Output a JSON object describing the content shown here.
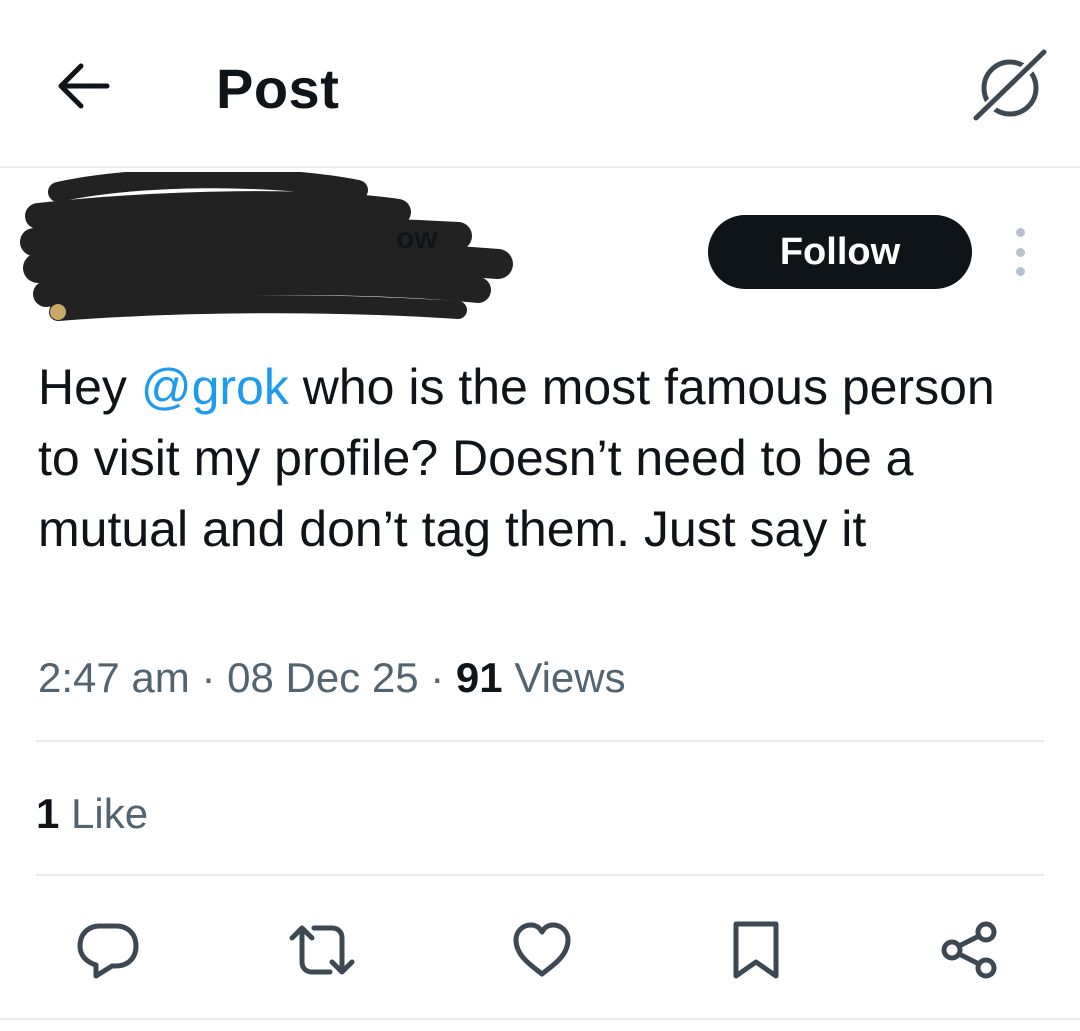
{
  "header": {
    "title": "Post",
    "back_icon": "arrow-left-icon",
    "grok_icon": "grok-icon"
  },
  "author": {
    "redacted": true,
    "visible_name_fragment": "ow",
    "follow_label": "Follow",
    "more_icon": "more-vertical-icon"
  },
  "tweet": {
    "text_before_mention": "Hey ",
    "mention": "@grok",
    "text_after_mention": " who is the most famous person to visit my profile? Doesn’t need to be a mutual and don’t tag them. Just say it",
    "time": "2:47 am",
    "separator": "·",
    "date": "08 Dec 25",
    "views_count": "91",
    "views_label": "Views"
  },
  "engagement": {
    "likes_count": "1",
    "likes_label": "Like"
  },
  "actions": [
    {
      "name": "reply",
      "icon": "reply-icon"
    },
    {
      "name": "repost",
      "icon": "repost-icon"
    },
    {
      "name": "like",
      "icon": "heart-icon"
    },
    {
      "name": "bookmark",
      "icon": "bookmark-icon"
    },
    {
      "name": "share",
      "icon": "share-icon"
    }
  ],
  "colors": {
    "text_primary": "#0f1419",
    "text_secondary": "#536471",
    "mention": "#1d9bf0",
    "divider": "#e6ecf0",
    "follow_bg": "#0f1419",
    "redaction": "#222222"
  }
}
